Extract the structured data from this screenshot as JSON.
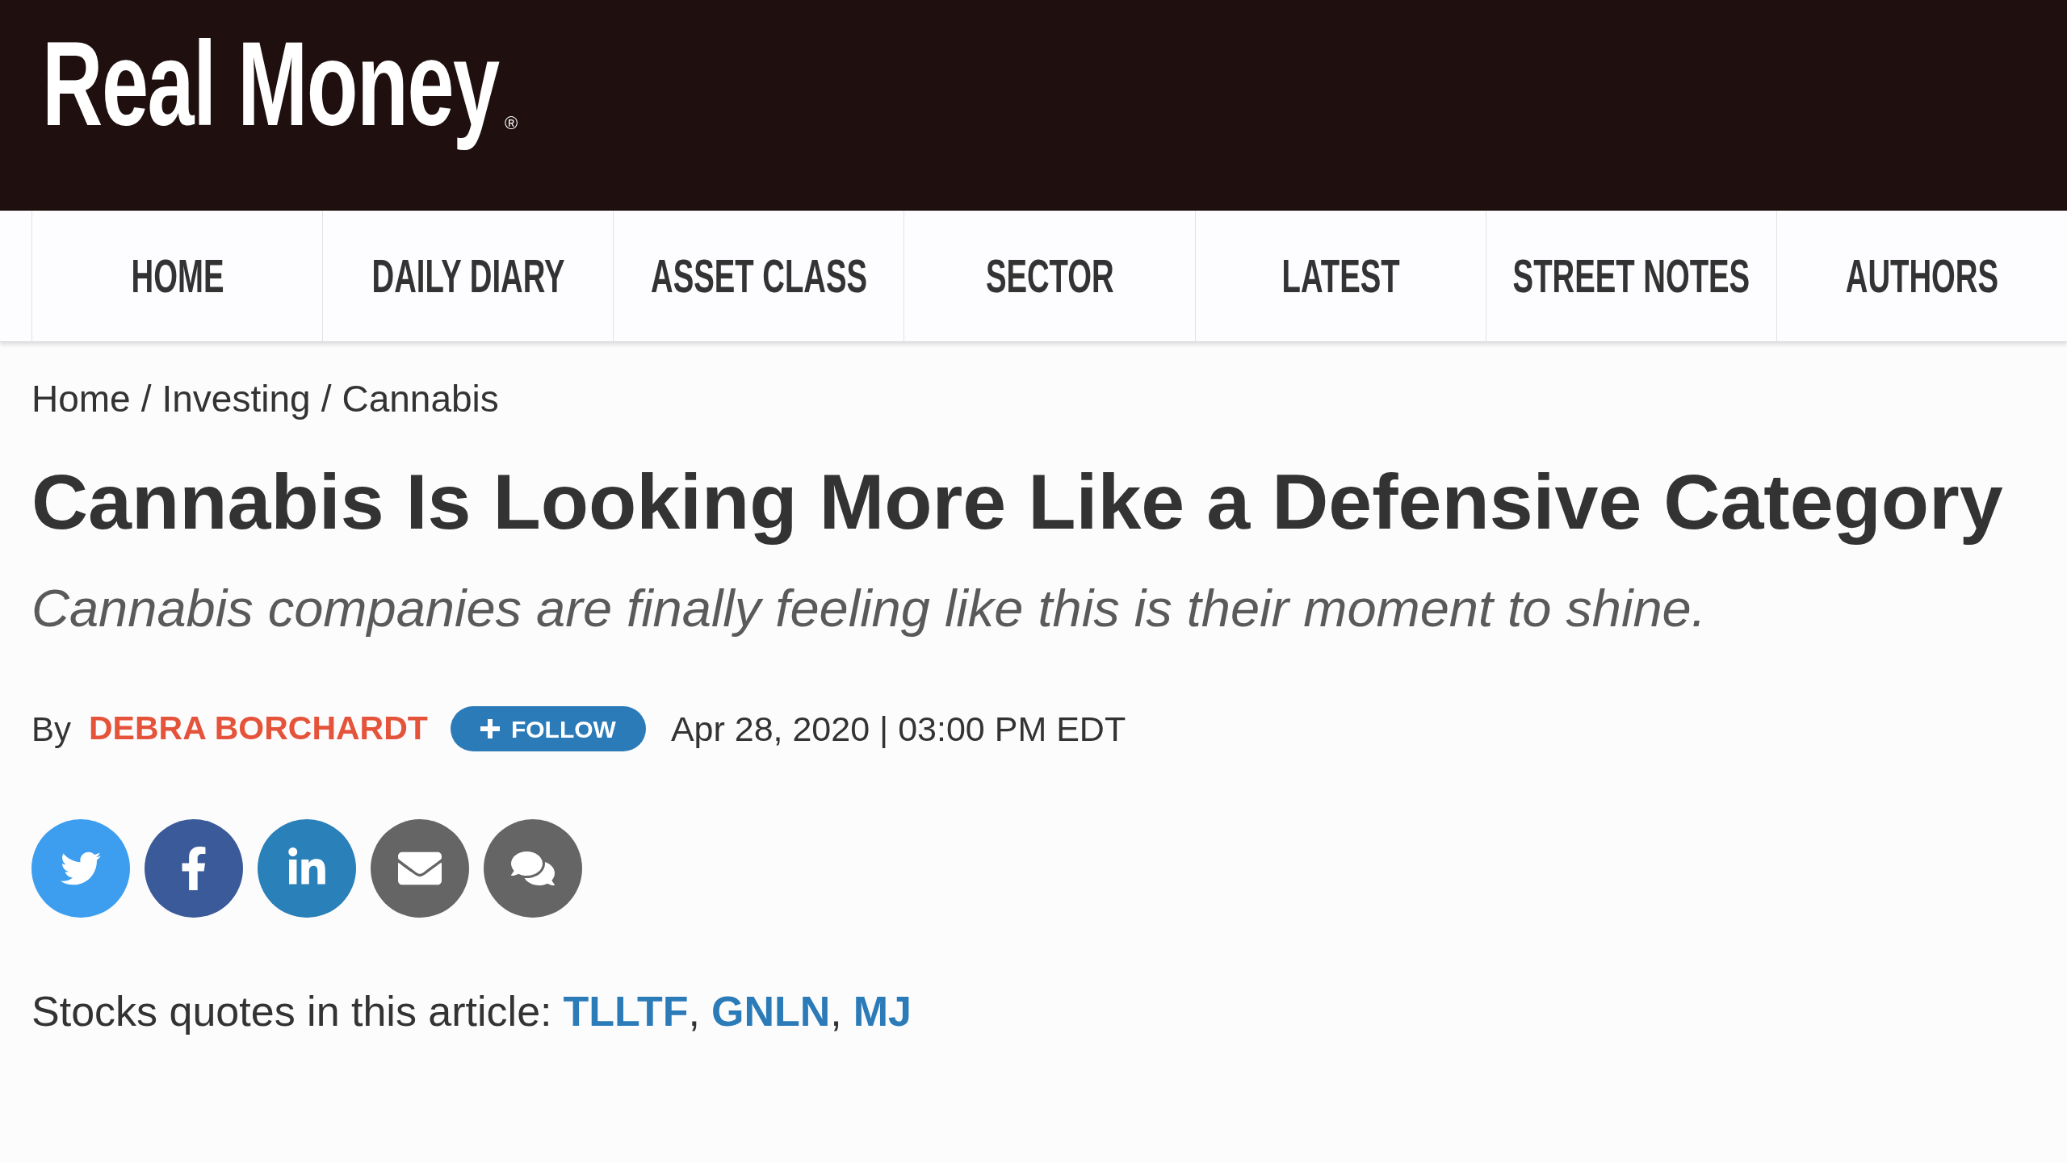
{
  "header": {
    "logo": {
      "text": "Real Money",
      "mark": "®"
    }
  },
  "nav": {
    "items": [
      "HOME",
      "DAILY DIARY",
      "ASSET CLASS",
      "SECTOR",
      "LATEST",
      "STREET NOTES",
      "AUTHORS"
    ]
  },
  "breadcrumbs": {
    "items": [
      "Home",
      "Investing",
      "Cannabis"
    ],
    "separator": "/"
  },
  "article": {
    "title": "Cannabis Is Looking More Like a Defensive Category",
    "subtitle": "Cannabis companies are finally feeling like this is their moment to shine.",
    "byline": {
      "prefix": "By",
      "author": "DEBRA BORCHARDT",
      "follow_button": {
        "label": "FOLLOW"
      },
      "date": "Apr 28, 2020 | 03:00 PM EDT"
    },
    "share_buttons": [
      {
        "kind": "twitter",
        "color": "#3d9ef0"
      },
      {
        "kind": "facebook",
        "color": "#3b5a9a"
      },
      {
        "kind": "linkedin",
        "color": "#2a80b9"
      },
      {
        "kind": "email",
        "color": "#666566"
      },
      {
        "kind": "comments",
        "color": "#666566"
      }
    ],
    "stock_quotes": {
      "label": "Stocks quotes in this article:",
      "tickers": [
        "TLLTF",
        "GNLN",
        "MJ"
      ],
      "separator": ","
    }
  }
}
